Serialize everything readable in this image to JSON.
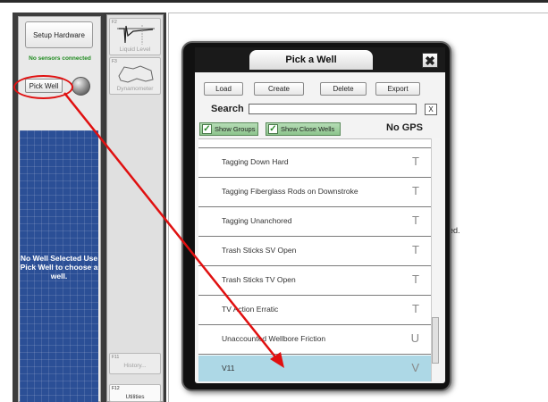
{
  "left_panel": {
    "setup_hardware_label": "Setup Hardware",
    "sensor_status": "No sensors connected",
    "pick_well_label": "Pick Well",
    "no_well_message": "No Well Selected Use Pick Well to choose a well."
  },
  "function_keys": [
    {
      "key": "F2",
      "label": "Liquid Level",
      "icon": "liquid-level-trace-icon"
    },
    {
      "key": "F3",
      "label": "Dynamometer",
      "icon": "dynamometer-card-icon"
    },
    {
      "key": "F11",
      "label": "History..."
    },
    {
      "key": "F12",
      "label": "Utilities"
    }
  ],
  "background_text": "cted.",
  "dialog": {
    "title": "Pick a Well",
    "close_symbol": "✖",
    "buttons": [
      "Load",
      "Create",
      "Delete",
      "Export"
    ],
    "search_label": "Search",
    "search_value": "",
    "search_clear": "X",
    "toggles": [
      "Show Groups",
      "Show Close Wells"
    ],
    "gps_status": "No GPS",
    "wells": [
      {
        "name": "Tagging Down Hard",
        "tag": "T"
      },
      {
        "name": "Tagging Fiberglass Rods on Downstroke",
        "tag": "T"
      },
      {
        "name": "Tagging Unanchored",
        "tag": "T"
      },
      {
        "name": "Trash Sticks SV Open",
        "tag": "T"
      },
      {
        "name": "Trash Sticks TV Open",
        "tag": "T"
      },
      {
        "name": "TV Action Erratic",
        "tag": "T"
      },
      {
        "name": "Unaccounted Wellbore Friction",
        "tag": "U"
      },
      {
        "name": "V11",
        "tag": "V",
        "selected": true
      }
    ]
  },
  "colors": {
    "annotation": "#e01010",
    "selected_row": "#add8e6",
    "map_background": "#2b4f96",
    "sensor_status": "#1e8a1e"
  }
}
